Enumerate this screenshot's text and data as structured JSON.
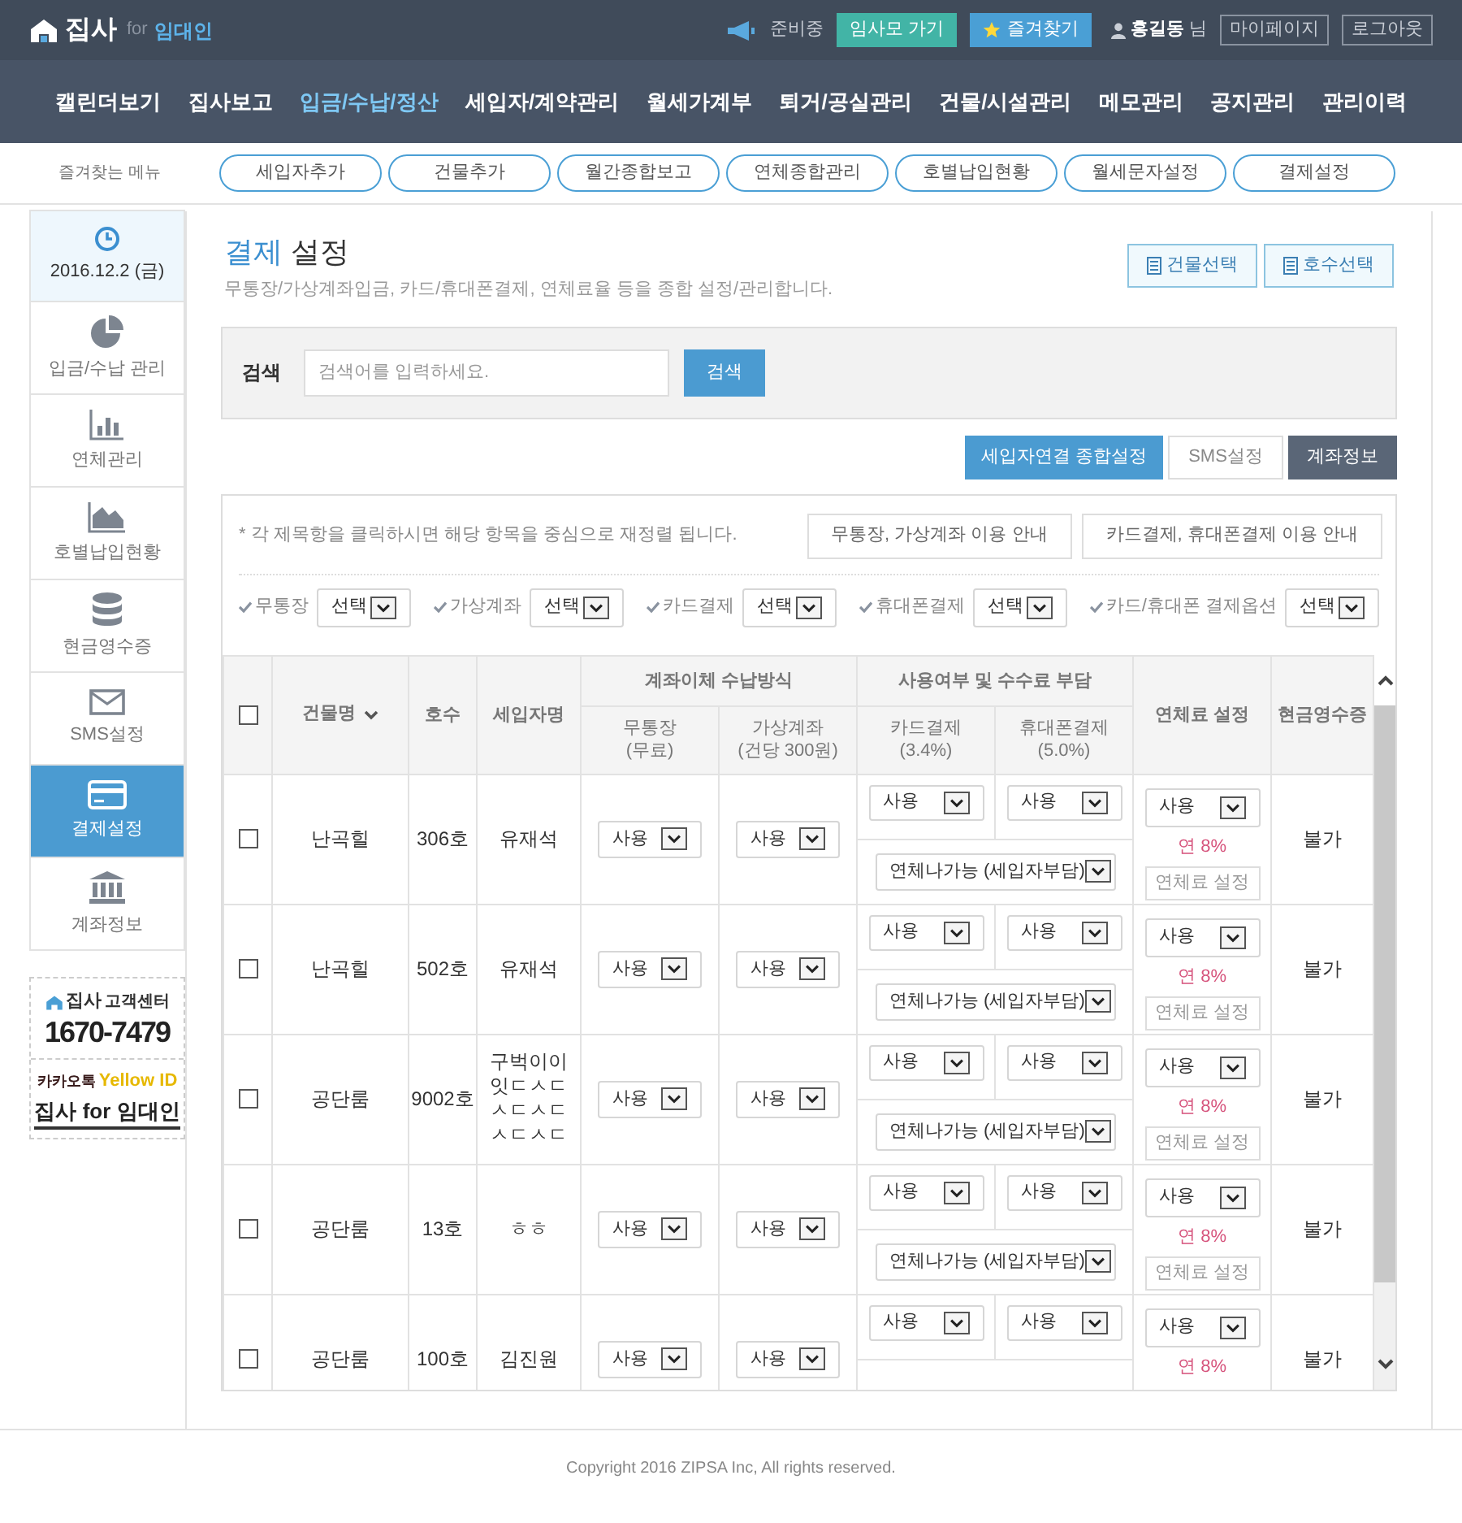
{
  "header": {
    "logo": "집사",
    "logo_for": "for",
    "logo_role": "임대인",
    "notice": "준비중",
    "buttons": [
      {
        "label": "임사모 가기",
        "kind": "teal"
      },
      {
        "label": "즐겨찾기",
        "kind": "favorite"
      }
    ],
    "user_name": "홍길동",
    "user_suffix": "님",
    "links": [
      "마이페이지",
      "로그아웃"
    ]
  },
  "nav": [
    {
      "label": "캘린더보기",
      "selected": false
    },
    {
      "label": "집사보고",
      "selected": false
    },
    {
      "label": "입금/수납/정산",
      "selected": true
    },
    {
      "label": "세입자/계약관리",
      "selected": false
    },
    {
      "label": "월세가계부",
      "selected": false
    },
    {
      "label": "퇴거/공실관리",
      "selected": false
    },
    {
      "label": "건물/시설관리",
      "selected": false
    },
    {
      "label": "메모관리",
      "selected": false
    },
    {
      "label": "공지관리",
      "selected": false
    },
    {
      "label": "관리이력",
      "selected": false
    }
  ],
  "favorites": {
    "title": "즐겨찾는 메뉴",
    "items": [
      "세입자추가",
      "건물추가",
      "월간종합보고",
      "연체종합관리",
      "호별납입현황",
      "월세문자설정",
      "결제설정"
    ]
  },
  "sidebar": {
    "items": [
      {
        "label": "2016.12.2 (금)",
        "kind": "date",
        "selected": false
      },
      {
        "label": "입금/수납 관리",
        "kind": "menu",
        "selected": false
      },
      {
        "label": "연체관리",
        "kind": "menu",
        "selected": false
      },
      {
        "label": "호별납입현황",
        "kind": "menu",
        "selected": false
      },
      {
        "label": "현금영수증",
        "kind": "menu",
        "selected": false
      },
      {
        "label": "SMS설정",
        "kind": "menu",
        "selected": false
      },
      {
        "label": "결제설정",
        "kind": "menu",
        "selected": true
      },
      {
        "label": "계좌정보",
        "kind": "menu",
        "selected": false
      }
    ],
    "support": {
      "brand": "집사",
      "label": "고객센터",
      "phone": "1670-7479"
    },
    "kakao": {
      "kakao": "카카오톡",
      "yellow_id": "Yellow ID",
      "name": "집사 for 임대인"
    }
  },
  "page": {
    "title_accent": "결제",
    "title_rest": "설정",
    "description": "무통장/가상계좌입금, 카드/휴대폰결제, 연체료율 등을 종합 설정/관리합니다.",
    "top_buttons": [
      "건물선택",
      "호수선택"
    ]
  },
  "search": {
    "label": "검색",
    "placeholder": "검색어를 입력하세요.",
    "button": "검색"
  },
  "action_buttons": [
    {
      "label": "세입자연결 종합설정",
      "kind": "primary"
    },
    {
      "label": "SMS설정",
      "kind": "default"
    },
    {
      "label": "계좌정보",
      "kind": "dark"
    }
  ],
  "notice": "* 각 제목항을 클릭하시면 해당 항목을 중심으로 재정렬 됩니다.",
  "guide_buttons": [
    "무통장, 가상계좌 이용 안내",
    "카드결제, 휴대폰결제 이용 안내"
  ],
  "filters": [
    {
      "label": "무통장",
      "value": "선택"
    },
    {
      "label": "가상계좌",
      "value": "선택"
    },
    {
      "label": "카드결제",
      "value": "선택"
    },
    {
      "label": "휴대폰결제",
      "value": "선택"
    },
    {
      "label": "카드/휴대폰 결제옵션",
      "value": "선택"
    }
  ],
  "table": {
    "all_checked": false,
    "columns": {
      "building": "건물명",
      "unit": "호수",
      "tenant": "세입자명",
      "transfer_group": "계좌이체 수납방식",
      "bank": "무통장\n(무료)",
      "virtual": "가상계좌\n(건당 300원)",
      "usage_group": "사용여부 및 수수료 부담",
      "card": "카드결제\n(3.4%)",
      "phone": "휴대폰결제\n(5.0%)",
      "late_fee": "연체료 설정",
      "receipt": "현금영수증"
    },
    "rows": [
      {
        "checked": false,
        "building": "난곡힐",
        "unit": "306호",
        "tenant": "유재석",
        "bank": "사용",
        "virtual": "사용",
        "card": "사용",
        "phone": "사용",
        "late_option": "연체나가능 (세입자부담)",
        "late_fee": "사용",
        "rate": "연 8%",
        "fee_button": "연체료 설정",
        "receipt": "불가"
      },
      {
        "checked": false,
        "building": "난곡힐",
        "unit": "502호",
        "tenant": "유재석",
        "bank": "사용",
        "virtual": "사용",
        "card": "사용",
        "phone": "사용",
        "late_option": "연체나가능 (세입자부담)",
        "late_fee": "사용",
        "rate": "연 8%",
        "fee_button": "연체료 설정",
        "receipt": "불가"
      },
      {
        "checked": false,
        "building": "공단룸",
        "unit": "9002호",
        "tenant": "구벅이이잇ㄷㅅㄷㅅㄷㅅㄷㅅㄷㅅㄷ",
        "bank": "사용",
        "virtual": "사용",
        "card": "사용",
        "phone": "사용",
        "late_option": "연체나가능 (세입자부담)",
        "late_fee": "사용",
        "rate": "연 8%",
        "fee_button": "연체료 설정",
        "receipt": "불가"
      },
      {
        "checked": false,
        "building": "공단룸",
        "unit": "13호",
        "tenant": "ㅎㅎ",
        "bank": "사용",
        "virtual": "사용",
        "card": "사용",
        "phone": "사용",
        "late_option": "연체나가능 (세입자부담)",
        "late_fee": "사용",
        "rate": "연 8%",
        "fee_button": "연체료 설정",
        "receipt": "불가"
      },
      {
        "checked": false,
        "building": "공단룸",
        "unit": "100호",
        "tenant": "김진원",
        "bank": "사용",
        "virtual": "사용",
        "card": "사용",
        "phone": "사용",
        "late_fee": "사용",
        "rate": "연 8%",
        "receipt": "불가"
      }
    ]
  },
  "footer": "Copyright 2016 ZIPSA Inc, All rights reserved."
}
